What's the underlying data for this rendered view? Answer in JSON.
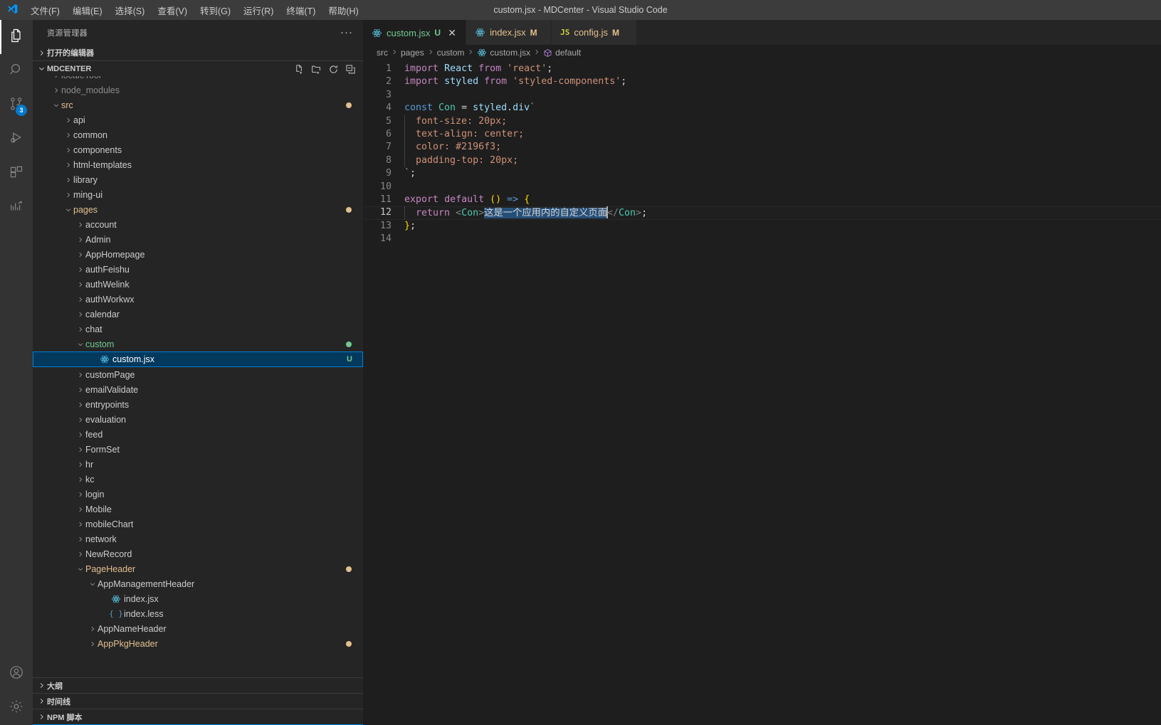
{
  "titlebar": {
    "window_title": "custom.jsx - MDCenter - Visual Studio Code",
    "logo_name": "vscode-logo",
    "menus": [
      {
        "label": "文件(F)",
        "name": "menu-file"
      },
      {
        "label": "编辑(E)",
        "name": "menu-edit"
      },
      {
        "label": "选择(S)",
        "name": "menu-selection"
      },
      {
        "label": "查看(V)",
        "name": "menu-view"
      },
      {
        "label": "转到(G)",
        "name": "menu-go"
      },
      {
        "label": "运行(R)",
        "name": "menu-run"
      },
      {
        "label": "终端(T)",
        "name": "menu-terminal"
      },
      {
        "label": "帮助(H)",
        "name": "menu-help"
      }
    ]
  },
  "activitybar": {
    "items": [
      {
        "icon": "explorer-files-icon",
        "active": true,
        "badge": ""
      },
      {
        "icon": "search-icon",
        "active": false,
        "badge": ""
      },
      {
        "icon": "source-control-icon",
        "active": false,
        "badge": "3"
      },
      {
        "icon": "run-debug-icon",
        "active": false,
        "badge": ""
      },
      {
        "icon": "extensions-icon",
        "active": false,
        "badge": ""
      },
      {
        "icon": "testing-chart-icon",
        "active": false,
        "badge": ""
      }
    ],
    "bottom": [
      {
        "icon": "account-icon"
      },
      {
        "icon": "settings-gear-icon"
      }
    ],
    "badge_color": "#007acc"
  },
  "sidebar": {
    "title": "资源管理器",
    "more_label": "···",
    "open_editors_label": "打开的编辑器",
    "project_label": "MDCENTER",
    "toolbar": [
      {
        "name": "new-file-icon"
      },
      {
        "name": "new-folder-icon"
      },
      {
        "name": "refresh-icon"
      },
      {
        "name": "collapse-all-icon"
      }
    ],
    "bottom_sections": [
      {
        "label": "大纲",
        "name": "section-outline"
      },
      {
        "label": "时间线",
        "name": "section-timeline"
      },
      {
        "label": "NPM 脚本",
        "name": "section-npm-scripts"
      }
    ],
    "tree": [
      {
        "label": "localeTool",
        "indent": 1,
        "type": "folder",
        "state": "collapsed",
        "color": "dim"
      },
      {
        "label": "node_modules",
        "indent": 1,
        "type": "folder",
        "state": "collapsed",
        "color": "dim"
      },
      {
        "label": "src",
        "indent": 1,
        "type": "folder",
        "state": "expanded",
        "color": "mod",
        "dot": "#e2c08d"
      },
      {
        "label": "api",
        "indent": 2,
        "type": "folder",
        "state": "collapsed",
        "color": "normal"
      },
      {
        "label": "common",
        "indent": 2,
        "type": "folder",
        "state": "collapsed",
        "color": "normal"
      },
      {
        "label": "components",
        "indent": 2,
        "type": "folder",
        "state": "collapsed",
        "color": "normal"
      },
      {
        "label": "html-templates",
        "indent": 2,
        "type": "folder",
        "state": "collapsed",
        "color": "normal"
      },
      {
        "label": "library",
        "indent": 2,
        "type": "folder",
        "state": "collapsed",
        "color": "normal"
      },
      {
        "label": "ming-ui",
        "indent": 2,
        "type": "folder",
        "state": "collapsed",
        "color": "normal"
      },
      {
        "label": "pages",
        "indent": 2,
        "type": "folder",
        "state": "expanded",
        "color": "mod",
        "dot": "#e2c08d"
      },
      {
        "label": "account",
        "indent": 3,
        "type": "folder",
        "state": "collapsed",
        "color": "normal"
      },
      {
        "label": "Admin",
        "indent": 3,
        "type": "folder",
        "state": "collapsed",
        "color": "normal"
      },
      {
        "label": "AppHomepage",
        "indent": 3,
        "type": "folder",
        "state": "collapsed",
        "color": "normal"
      },
      {
        "label": "authFeishu",
        "indent": 3,
        "type": "folder",
        "state": "collapsed",
        "color": "normal"
      },
      {
        "label": "authWelink",
        "indent": 3,
        "type": "folder",
        "state": "collapsed",
        "color": "normal"
      },
      {
        "label": "authWorkwx",
        "indent": 3,
        "type": "folder",
        "state": "collapsed",
        "color": "normal"
      },
      {
        "label": "calendar",
        "indent": 3,
        "type": "folder",
        "state": "collapsed",
        "color": "normal"
      },
      {
        "label": "chat",
        "indent": 3,
        "type": "folder",
        "state": "collapsed",
        "color": "normal"
      },
      {
        "label": "custom",
        "indent": 3,
        "type": "folder",
        "state": "expanded",
        "color": "new",
        "dot": "#73c991"
      },
      {
        "label": "custom.jsx",
        "indent": 4,
        "type": "react",
        "state": "file",
        "color": "sel",
        "selected": true,
        "deco": "U",
        "deco_color": "#73c991"
      },
      {
        "label": "customPage",
        "indent": 3,
        "type": "folder",
        "state": "collapsed",
        "color": "normal"
      },
      {
        "label": "emailValidate",
        "indent": 3,
        "type": "folder",
        "state": "collapsed",
        "color": "normal"
      },
      {
        "label": "entrypoints",
        "indent": 3,
        "type": "folder",
        "state": "collapsed",
        "color": "normal"
      },
      {
        "label": "evaluation",
        "indent": 3,
        "type": "folder",
        "state": "collapsed",
        "color": "normal"
      },
      {
        "label": "feed",
        "indent": 3,
        "type": "folder",
        "state": "collapsed",
        "color": "normal"
      },
      {
        "label": "FormSet",
        "indent": 3,
        "type": "folder",
        "state": "collapsed",
        "color": "normal"
      },
      {
        "label": "hr",
        "indent": 3,
        "type": "folder",
        "state": "collapsed",
        "color": "normal"
      },
      {
        "label": "kc",
        "indent": 3,
        "type": "folder",
        "state": "collapsed",
        "color": "normal"
      },
      {
        "label": "login",
        "indent": 3,
        "type": "folder",
        "state": "collapsed",
        "color": "normal"
      },
      {
        "label": "Mobile",
        "indent": 3,
        "type": "folder",
        "state": "collapsed",
        "color": "normal"
      },
      {
        "label": "mobileChart",
        "indent": 3,
        "type": "folder",
        "state": "collapsed",
        "color": "normal"
      },
      {
        "label": "network",
        "indent": 3,
        "type": "folder",
        "state": "collapsed",
        "color": "normal"
      },
      {
        "label": "NewRecord",
        "indent": 3,
        "type": "folder",
        "state": "collapsed",
        "color": "normal"
      },
      {
        "label": "PageHeader",
        "indent": 3,
        "type": "folder",
        "state": "expanded",
        "color": "mod",
        "dot": "#e2c08d"
      },
      {
        "label": "AppManagementHeader",
        "indent": 4,
        "type": "folder",
        "state": "expanded",
        "color": "normal"
      },
      {
        "label": "index.jsx",
        "indent": 5,
        "type": "react",
        "state": "file",
        "color": "normal"
      },
      {
        "label": "index.less",
        "indent": 5,
        "type": "less",
        "state": "file",
        "color": "normal"
      },
      {
        "label": "AppNameHeader",
        "indent": 4,
        "type": "folder",
        "state": "collapsed",
        "color": "normal"
      },
      {
        "label": "AppPkgHeader",
        "indent": 4,
        "type": "folder",
        "state": "collapsed",
        "color": "mod",
        "dot": "#e2c08d"
      }
    ]
  },
  "editor": {
    "tabs": [
      {
        "name": "custom.jsx",
        "icon": "react-icon",
        "status": "U",
        "status_color": "#73c991",
        "active": true,
        "closable": true,
        "close_label": "✕"
      },
      {
        "name": "index.jsx",
        "icon": "react-icon",
        "status": "M",
        "status_color": "#e2c08d",
        "active": false,
        "closable": false
      },
      {
        "name": "config.js",
        "icon": "js-icon",
        "status": "M",
        "status_color": "#e2c08d",
        "active": false,
        "closable": false
      }
    ],
    "breadcrumbs": [
      {
        "label": "src",
        "icon": ""
      },
      {
        "label": "pages",
        "icon": ""
      },
      {
        "label": "custom",
        "icon": ""
      },
      {
        "label": "custom.jsx",
        "icon": "react-icon"
      },
      {
        "label": "default",
        "icon": "symbol-object-icon"
      }
    ],
    "active_line": 12,
    "lines": [
      {
        "n": 1,
        "text": "import React from 'react';"
      },
      {
        "n": 2,
        "text": "import styled from 'styled-components';"
      },
      {
        "n": 3,
        "text": ""
      },
      {
        "n": 4,
        "text": "const Con = styled.div`"
      },
      {
        "n": 5,
        "text": "  font-size: 20px;"
      },
      {
        "n": 6,
        "text": "  text-align: center;"
      },
      {
        "n": 7,
        "text": "  color: #2196f3;"
      },
      {
        "n": 8,
        "text": "  padding-top: 20px;"
      },
      {
        "n": 9,
        "text": "`;"
      },
      {
        "n": 10,
        "text": ""
      },
      {
        "n": 11,
        "text": "export default () => {"
      },
      {
        "n": 12,
        "text": "  return <Con>这是一个应用内的自定义页面</Con>;"
      },
      {
        "n": 13,
        "text": "};"
      },
      {
        "n": 14,
        "text": ""
      }
    ],
    "selected_text": "这是一个应用内的自定义页面",
    "css_color_value": "#2196f3"
  }
}
